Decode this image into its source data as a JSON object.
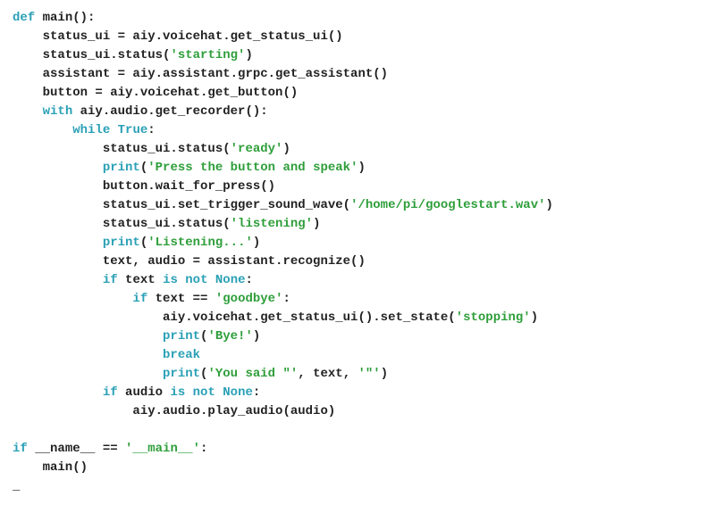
{
  "code": {
    "l1": {
      "kw": "def",
      "name": " main():"
    },
    "l2": "    status_ui = aiy.voicehat.get_status_ui()",
    "l3": {
      "pre": "    status_ui.status(",
      "str": "'starting'",
      "post": ")"
    },
    "l4": "    assistant = aiy.assistant.grpc.get_assistant()",
    "l5": "    button = aiy.voicehat.get_button()",
    "l6": {
      "kw": "with",
      "rest": " aiy.audio.get_recorder():"
    },
    "l7": {
      "kw": "while",
      "sp": " ",
      "bl": "True",
      "post": ":"
    },
    "l8": {
      "pre": "            status_ui.status(",
      "str": "'ready'",
      "post": ")"
    },
    "l9": {
      "fn": "print",
      "pre": "(",
      "str": "'Press the button and speak'",
      "post": ")"
    },
    "l10": "            button.wait_for_press()",
    "l11": {
      "pre": "            status_ui.set_trigger_sound_wave(",
      "str": "'/home/pi/googlestart.wav'",
      "post": ")"
    },
    "l12": {
      "pre": "            status_ui.status(",
      "str": "'listening'",
      "post": ")"
    },
    "l13": {
      "fn": "print",
      "pre": "(",
      "str": "'Listening...'",
      "post": ")"
    },
    "l14": "            text, audio = assistant.recognize()",
    "l15": {
      "kw": "if",
      "mid": " text ",
      "kw2": "is not",
      "sp": " ",
      "bl": "None",
      "post": ":"
    },
    "l16": {
      "kw": "if",
      "mid": " text == ",
      "str": "'goodbye'",
      "post": ":"
    },
    "l17": {
      "pre": "                    aiy.voicehat.get_status_ui().set_state(",
      "str": "'stopping'",
      "post": ")"
    },
    "l18": {
      "fn": "print",
      "pre": "(",
      "str": "'Bye!'",
      "post": ")"
    },
    "l19": {
      "kw": "break"
    },
    "l20": {
      "fn": "print",
      "pre": "(",
      "str1": "'You said \"'",
      "mid": ", text, ",
      "str2": "'\"'",
      "post": ")"
    },
    "l21": {
      "kw": "if",
      "mid": " audio ",
      "kw2": "is not",
      "sp": " ",
      "bl": "None",
      "post": ":"
    },
    "l22": "                aiy.audio.play_audio(audio)",
    "l23": "",
    "l24": {
      "kw": "if",
      "mid": " __name__ == ",
      "str": "'__main__'",
      "post": ":"
    },
    "l25": "    main()",
    "cursor": "_"
  }
}
